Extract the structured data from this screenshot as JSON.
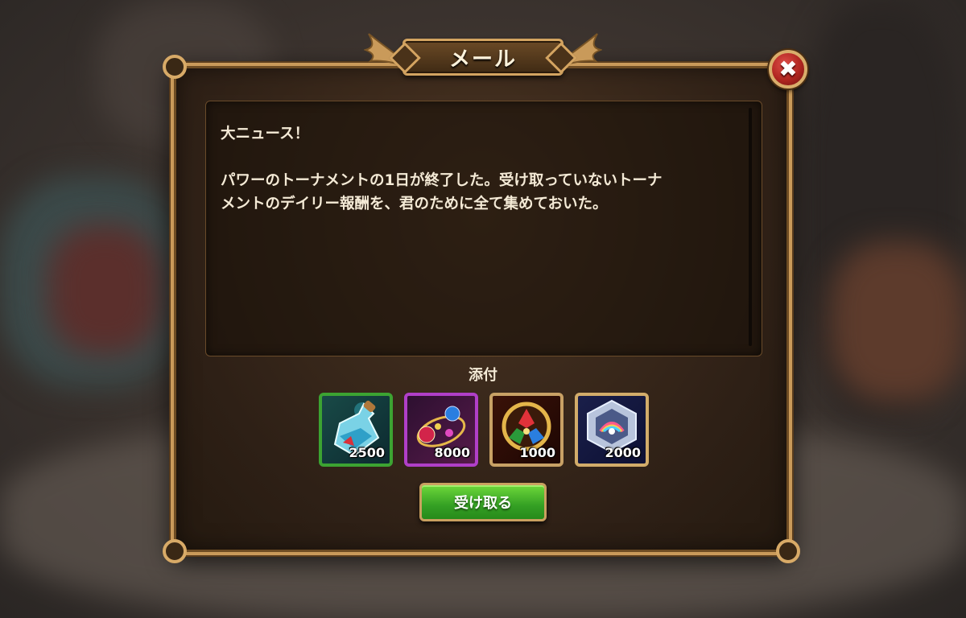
{
  "window": {
    "title": "メール"
  },
  "close": {
    "icon": "close-icon",
    "glyph": "✖"
  },
  "message": {
    "body": "大ニュース！\n\nパワーのトーナメントの1日が終了した。受け取っていないトーナ\nメントのデイリー報酬を、君のために全て集めておいた。"
  },
  "attachments": {
    "label": "添付",
    "items": [
      {
        "name": "potion-item",
        "quantity": "2500",
        "border_color": "#3ca332"
      },
      {
        "name": "gem-necklace-item",
        "quantity": "8000",
        "border_color": "#b03fc8"
      },
      {
        "name": "triad-gem-medallion-item",
        "quantity": "1000",
        "border_color": "#c8a165"
      },
      {
        "name": "hexagon-crest-item",
        "quantity": "2000",
        "border_color": "#d2ac6a"
      }
    ]
  },
  "actions": {
    "claim_label": "受け取る"
  },
  "colors": {
    "frame_gold": "#c99a5a",
    "claim_green": "#34a024",
    "close_red": "#b02520"
  }
}
